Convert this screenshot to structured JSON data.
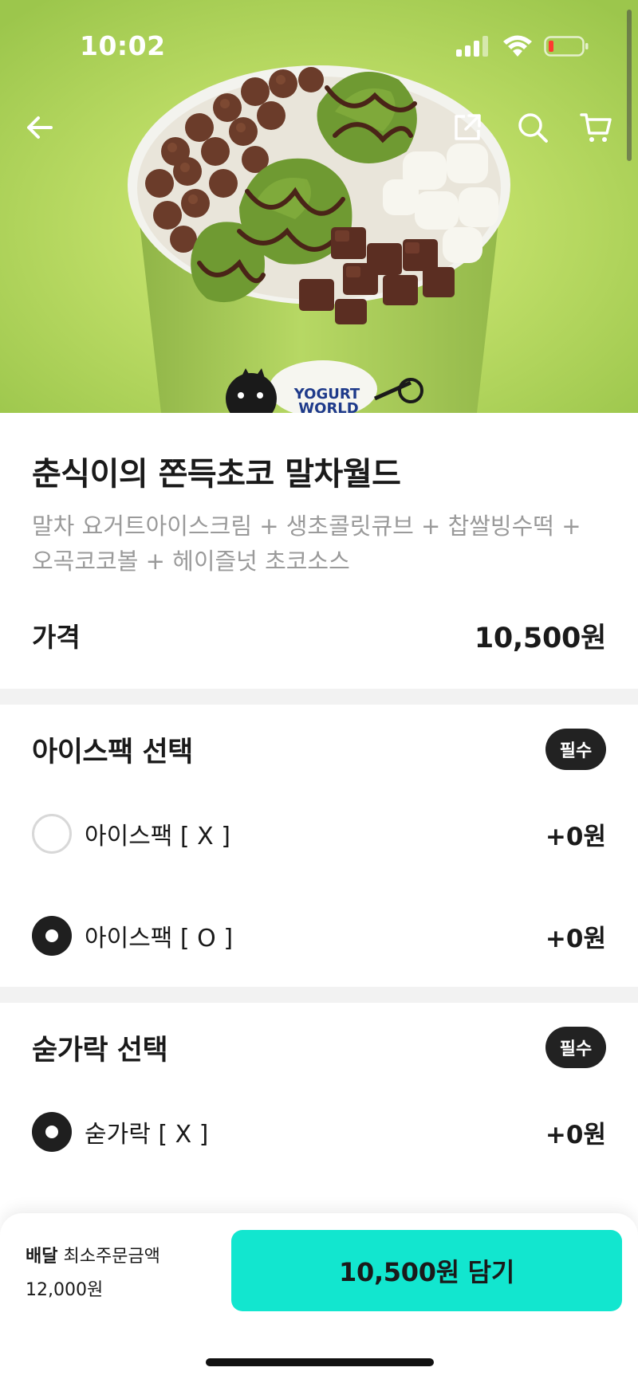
{
  "status_bar": {
    "time": "10:02"
  },
  "hero": {
    "cup_logo_line1": "YOGURT",
    "cup_logo_line2": "WORLD",
    "colors": {
      "background": "#c4e46a",
      "cup": "#a9cc58"
    }
  },
  "navbar": {
    "icons": [
      "back-arrow-icon",
      "share-icon",
      "search-icon",
      "cart-icon"
    ]
  },
  "product": {
    "title": "춘식이의 쫀득초코 말차월드",
    "description_line1": "말차 요거트아이스크림 + 생초콜릿큐브 + 찹쌀빙수떡 +",
    "description_line2": "오곡코코볼 + 헤이즐넛 초코소스",
    "price_label": "가격",
    "price_value": "10,500원"
  },
  "ice_pack_section": {
    "title": "아이스팩 선택",
    "badge": "필수",
    "options": [
      {
        "label": "아이스팩 [ X ]",
        "price": "+0원",
        "selected": false
      },
      {
        "label": "아이스팩 [ O ]",
        "price": "+0원",
        "selected": true
      }
    ]
  },
  "spoon_section": {
    "title": "숟가락 선택",
    "badge": "필수",
    "options": [
      {
        "label": "숟가락 [ X ]",
        "price": "+0원",
        "selected": true
      }
    ]
  },
  "bottom_bar": {
    "delivery_tag": "배달",
    "min_order_label": "최소주문금액",
    "min_order_value": "12,000원",
    "add_button_label": "10,500원 담기",
    "colors": {
      "add_button": "#12e6cf"
    }
  }
}
